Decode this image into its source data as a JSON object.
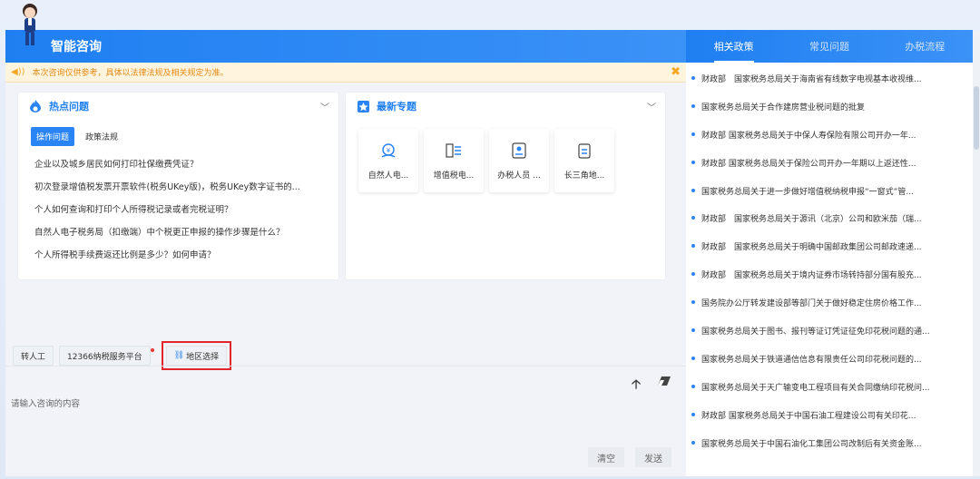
{
  "header": {
    "title": "智能咨询"
  },
  "notice": {
    "text": "本次咨询仅供参考，具体以法律法规及相关规定为准。",
    "close": "✖"
  },
  "hot": {
    "title": "热点问题",
    "tabs": [
      "操作问题",
      "政策法规"
    ],
    "questions": [
      "企业以及城乡居民如何打印社保缴费凭证？",
      "初次登录增值税发票开票软件(税务UKey版)，税务UKey数字证书的...",
      "个人如何查询和打印个人所得税记录或者完税证明？",
      "自然人电子税务局（扣缴端）中个税更正申报的操作步骤是什么？",
      "个人所得税手续费返还比例是多少？如何申请？"
    ]
  },
  "topics": {
    "title": "最新专题",
    "items": [
      {
        "label": "自然人电...",
        "icon": "money-bag-icon"
      },
      {
        "label": "增值税电...",
        "icon": "tax-doc-icon"
      },
      {
        "label": "办税人员 ...",
        "icon": "id-card-icon"
      },
      {
        "label": "长三角地...",
        "icon": "clipboard-icon"
      }
    ]
  },
  "actions": {
    "transfer": "转人工",
    "service": "12366纳税服务平台",
    "region": "地区选择"
  },
  "input": {
    "placeholder": "请输入咨询的内容",
    "clear": "清空",
    "send": "发送"
  },
  "right": {
    "tabs": [
      "相关政策",
      "常见问题",
      "办税流程"
    ],
    "policies": [
      "财政部　国家税务总局关于海南省有线数字电视基本收视维...",
      "国家税务总局关于合作建房营业税问题的批复",
      "财政部 国家税务总局关于中保人寿保险有限公司开办一年...",
      "财政部 国家税务总局关于保险公司开办一年期以上返还性...",
      "国家税务总局关于进一步做好增值税纳税申报“一窗式”管...",
      "财政部　国家税务总局关于源讯（北京）公司和欧米茄（瑞...",
      "财政部　国家税务总局关于明确中国邮政集团公司邮政速递...",
      "财政部　国家税务总局关于境内证券市场转持部分国有股充...",
      "国务院办公厅转发建设部等部门关于做好稳定住房价格工作...",
      "国家税务总局关于图书、报刊等证订凭证征免印花税问题的通...",
      "国家税务总局关于铁道通信信息有限责任公司印花税问题的...",
      "国家税务总局关于天广输变电工程项目有关合同缴纳印花税问...",
      "财政部 国家税务总局关于中国石油工程建设公司有关印花...",
      "国家税务总局关于中国石油化工集团公司改制后有关资金账..."
    ]
  },
  "colors": {
    "brand": "#1f7ff1",
    "notice": "#e58a18",
    "highlight": "#e1252b"
  }
}
